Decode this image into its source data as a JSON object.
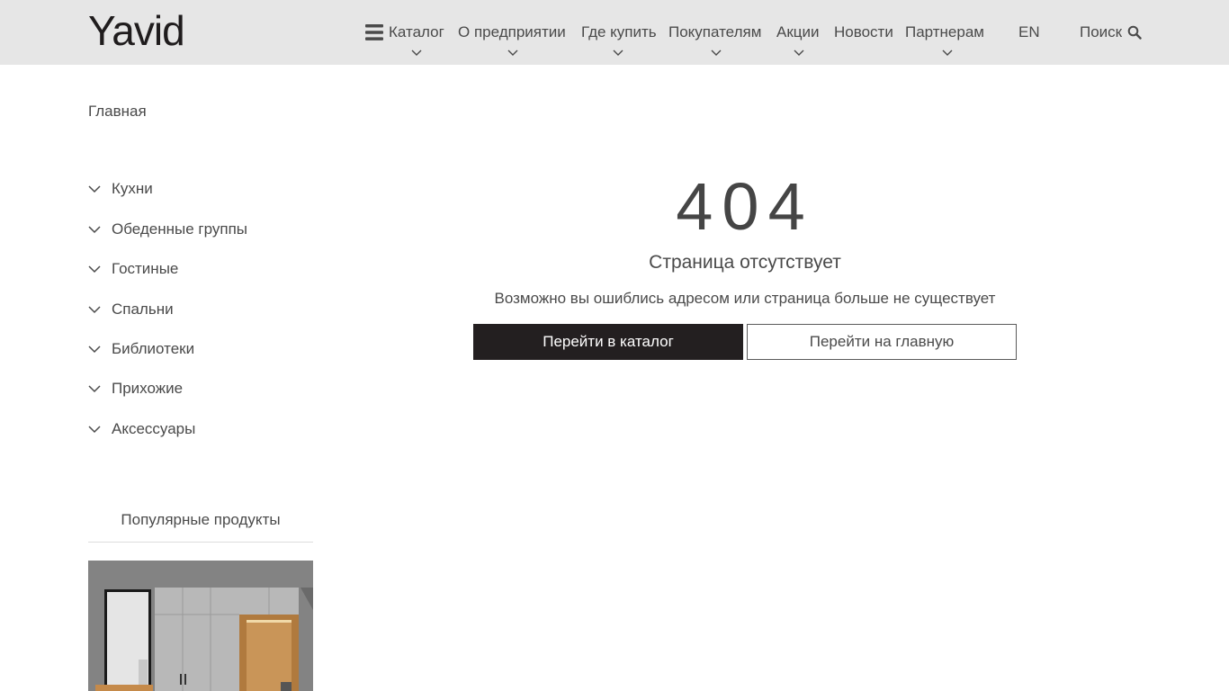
{
  "header": {
    "logo": "Yavid",
    "nav": [
      {
        "label": "Каталог"
      },
      {
        "label": "О предприятии"
      },
      {
        "label": "Где купить"
      },
      {
        "label": "Покупателям"
      },
      {
        "label": "Акции"
      },
      {
        "label": "Новости"
      },
      {
        "label": "Партнерам"
      }
    ],
    "lang": "EN",
    "search_label": "Поиск"
  },
  "breadcrumb": "Главная",
  "sidebar": {
    "categories": [
      "Кухни",
      "Обеденные группы",
      "Гостиные",
      "Спальни",
      "Библиотеки",
      "Прихожие",
      "Аксессуары"
    ],
    "popular_title": "Популярные продукты"
  },
  "error": {
    "code": "404",
    "title": "Страница отсутствует",
    "description": "Возможно вы ошиблись адресом или страница больше не существует",
    "btn_catalog": "Перейти в каталог",
    "btn_home": "Перейти на главную"
  },
  "colors": {
    "header_bg": "#e6e6e6",
    "dark_button": "#231f20",
    "text": "#4a4a4a"
  }
}
